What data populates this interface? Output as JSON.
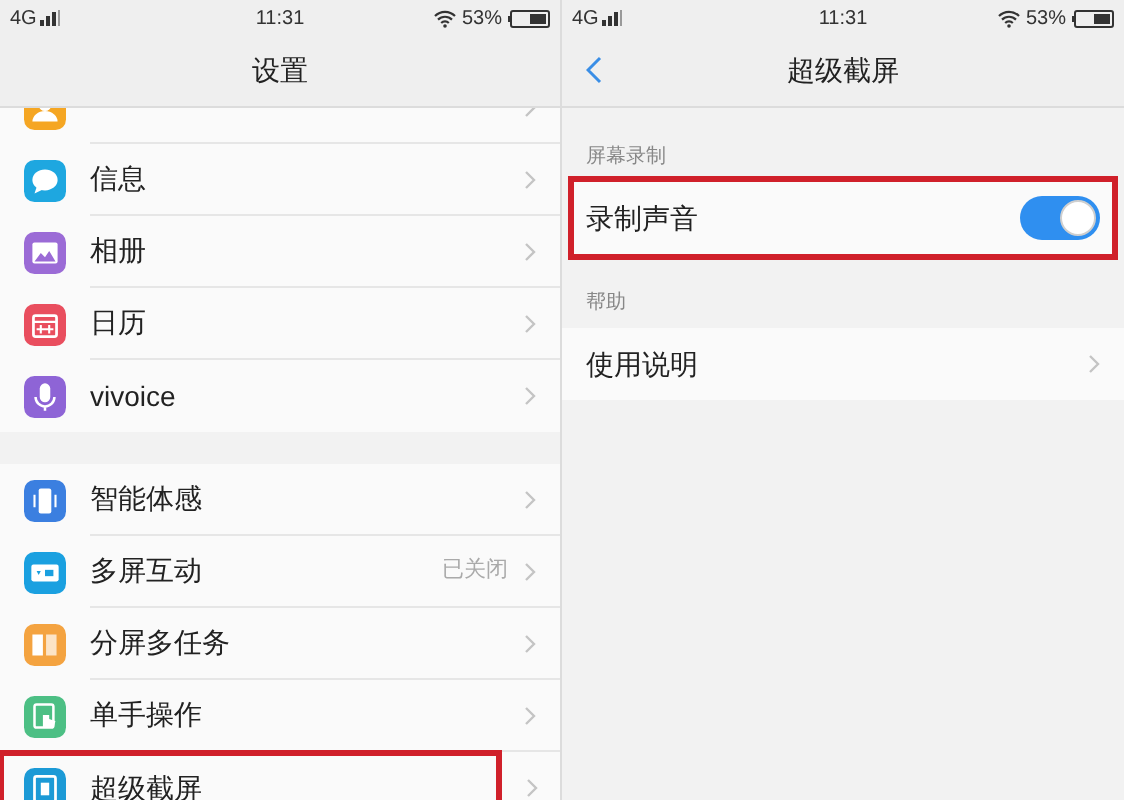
{
  "left_screen": {
    "status_bar": {
      "network": "4G",
      "time": "11:31",
      "battery": "53%"
    },
    "title": "设置",
    "groups": [
      {
        "items": [
          {
            "kind": "person",
            "color": "#f5a623",
            "cut": true,
            "highlighted": false
          },
          {
            "kind": "bubble",
            "color": "#1ea7e0",
            "label": "信息",
            "highlighted": false
          },
          {
            "kind": "photo",
            "color": "#9b6bd6",
            "label": "相册",
            "highlighted": false
          },
          {
            "kind": "calendar",
            "color": "#e94e5e",
            "label": "日历",
            "highlighted": false
          },
          {
            "kind": "mic",
            "color": "#8e64d6",
            "label": "vivoice",
            "highlighted": false
          }
        ]
      },
      {
        "items": [
          {
            "kind": "phone",
            "color": "#3b7fe0",
            "label": "智能体感",
            "highlighted": false
          },
          {
            "kind": "screen",
            "color": "#1aa0e0",
            "label": "多屏互动",
            "value": "已关闭",
            "highlighted": false
          },
          {
            "kind": "split",
            "color": "#f4a340",
            "label": "分屏多任务",
            "highlighted": false
          },
          {
            "kind": "hand",
            "color": "#4cbf84",
            "label": "单手操作",
            "highlighted": false
          },
          {
            "kind": "frame",
            "color": "#1c9ad6",
            "label": "超级截屏",
            "highlighted": true
          }
        ]
      }
    ]
  },
  "right_screen": {
    "status_bar": {
      "network": "4G",
      "time": "11:31",
      "battery": "53%"
    },
    "title": "超级截屏",
    "sections": [
      {
        "header": "屏幕录制",
        "items": [
          {
            "kind": "toggle",
            "label": "录制声音",
            "on": true,
            "highlighted": true
          }
        ]
      },
      {
        "header": "帮助",
        "items": [
          {
            "kind": "link",
            "label": "使用说明",
            "highlighted": false
          }
        ]
      }
    ]
  }
}
